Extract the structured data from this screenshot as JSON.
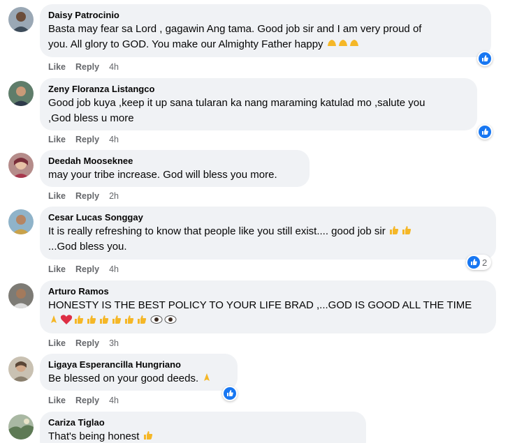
{
  "colors": {
    "bubble": "#f0f2f5",
    "meta_text": "#65676b",
    "like_blue": "#1877f2"
  },
  "icons": {
    "reaction": "like-thumbs-up-icon"
  },
  "comments": [
    {
      "author": "Daisy Patrocinio",
      "lines": [
        "Basta may fear sa Lord , gagawin Ang tama. Good job sir and I am very proud of",
        "you. All glory to GOD. You make our Almighty Father happy"
      ],
      "emoji_after": "raising-hands-emoji x3",
      "like": "Like",
      "reply": "Reply",
      "time": "4h",
      "reaction_count": ""
    },
    {
      "author": "Zeny Floranza Listangco",
      "lines": [
        "Good job kuya ,keep it up sana tularan ka nang maraming katulad mo ,salute you",
        ",God bless u more"
      ],
      "like": "Like",
      "reply": "Reply",
      "time": "4h",
      "reaction_count": ""
    },
    {
      "author": "Deedah Mooseknee",
      "lines": [
        "may your tribe increase. God will bless you more."
      ],
      "like": "Like",
      "reply": "Reply",
      "time": "2h"
    },
    {
      "author": "Cesar Lucas Songgay",
      "lines": [
        "It is really refreshing to know that people like you still exist.... good job sir",
        "...God bless you."
      ],
      "emoji_after": "thumbs-up-emoji x2",
      "like": "Like",
      "reply": "Reply",
      "time": "4h",
      "reaction_count": "2"
    },
    {
      "author": "Arturo Ramos",
      "lines": [
        "HONESTY IS THE BEST POLICY TO YOUR LIFE BRAD ,...GOD IS GOOD ALL THE TIME"
      ],
      "emoji_line": "folded-hands, red-heart, thumbs-up x6, eyes x2",
      "like": "Like",
      "reply": "Reply",
      "time": "3h"
    },
    {
      "author": "Ligaya Esperancilla Hungriano",
      "lines": [
        "Be blessed on your good deeds."
      ],
      "emoji_after": "folded-hands-emoji",
      "like": "Like",
      "reply": "Reply",
      "time": "4h",
      "reaction_count": ""
    },
    {
      "author": "Cariza Tiglao",
      "lines": [
        "That's being honest"
      ],
      "emoji_after": "thumbs-up-emoji"
    }
  ]
}
